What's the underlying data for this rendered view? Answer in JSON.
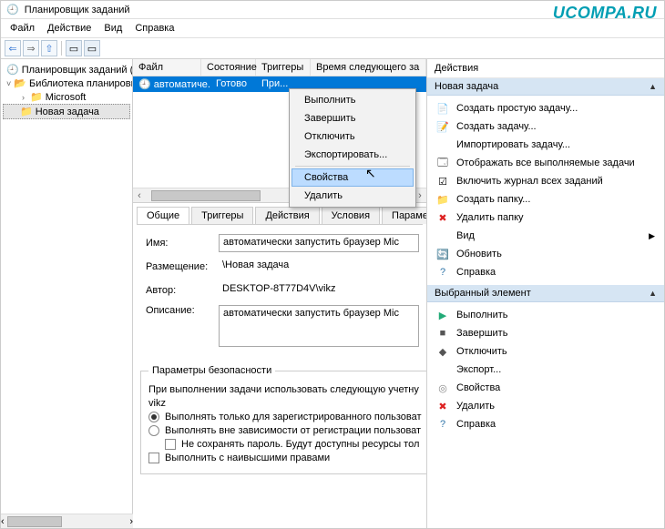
{
  "window": {
    "title": "Планировщик заданий"
  },
  "watermark": "UCOMPA.RU",
  "menubar": [
    "Файл",
    "Действие",
    "Вид",
    "Справка"
  ],
  "tree": {
    "root": "Планировщик заданий (Лок",
    "lib": "Библиотека планировщ",
    "ms": "Microsoft",
    "task": "Новая задача"
  },
  "list": {
    "cols": [
      "Файл",
      "Состояние",
      "Триггеры",
      "Время следующего за"
    ],
    "row": {
      "name": "автоматиче...",
      "state": "Готово",
      "trigger": "При..."
    }
  },
  "context": {
    "run": "Выполнить",
    "end": "Завершить",
    "disable": "Отключить",
    "export": "Экспортировать...",
    "props": "Свойства",
    "delete": "Удалить"
  },
  "tabs": [
    "Общие",
    "Триггеры",
    "Действия",
    "Условия",
    "Параметры"
  ],
  "form": {
    "name_l": "Имя:",
    "name_v": "автоматически запустить браузер Mic",
    "loc_l": "Размещение:",
    "loc_v": "\\Новая задача",
    "author_l": "Автор:",
    "author_v": "DESKTOP-8T77D4V\\vikz",
    "desc_l": "Описание:",
    "desc_v": "автоматически запустить браузер Mic"
  },
  "security": {
    "legend": "Параметры безопасности",
    "line1": "При выполнении задачи использовать следующую учетну",
    "user": "vikz",
    "r1": "Выполнять только для зарегистрированного пользоват",
    "r2": "Выполнять вне зависимости от регистрации пользоват",
    "c1": "Не сохранять пароль. Будут доступны ресурсы тол",
    "c2": "Выполнить с наивысшими правами"
  },
  "actions": {
    "head": "Действия",
    "sec1": "Новая задача",
    "sec2": "Выбранный элемент",
    "items1": [
      {
        "icon": "📄",
        "label": "Создать простую задачу..."
      },
      {
        "icon": "📝",
        "label": "Создать задачу..."
      },
      {
        "icon": "",
        "label": "Импортировать задачу..."
      },
      {
        "icon": "🗔",
        "label": "Отображать все выполняемые задачи"
      },
      {
        "icon": "☑",
        "label": "Включить журнал всех заданий"
      },
      {
        "icon": "📁",
        "label": "Создать папку..."
      },
      {
        "icon": "✖",
        "label": "Удалить папку",
        "color": "#d22"
      },
      {
        "icon": "",
        "label": "Вид",
        "sub": "▶"
      },
      {
        "icon": "🔄",
        "label": "Обновить",
        "color": "#2a7"
      },
      {
        "icon": "?",
        "label": "Справка",
        "color": "#37a"
      }
    ],
    "items2": [
      {
        "icon": "▶",
        "label": "Выполнить",
        "color": "#2a7"
      },
      {
        "icon": "■",
        "label": "Завершить",
        "color": "#555"
      },
      {
        "icon": "◆",
        "label": "Отключить",
        "color": "#555"
      },
      {
        "icon": "",
        "label": "Экспорт..."
      },
      {
        "icon": "◎",
        "label": "Свойства",
        "color": "#888"
      },
      {
        "icon": "✖",
        "label": "Удалить",
        "color": "#d22"
      },
      {
        "icon": "?",
        "label": "Справка",
        "color": "#37a"
      }
    ]
  }
}
